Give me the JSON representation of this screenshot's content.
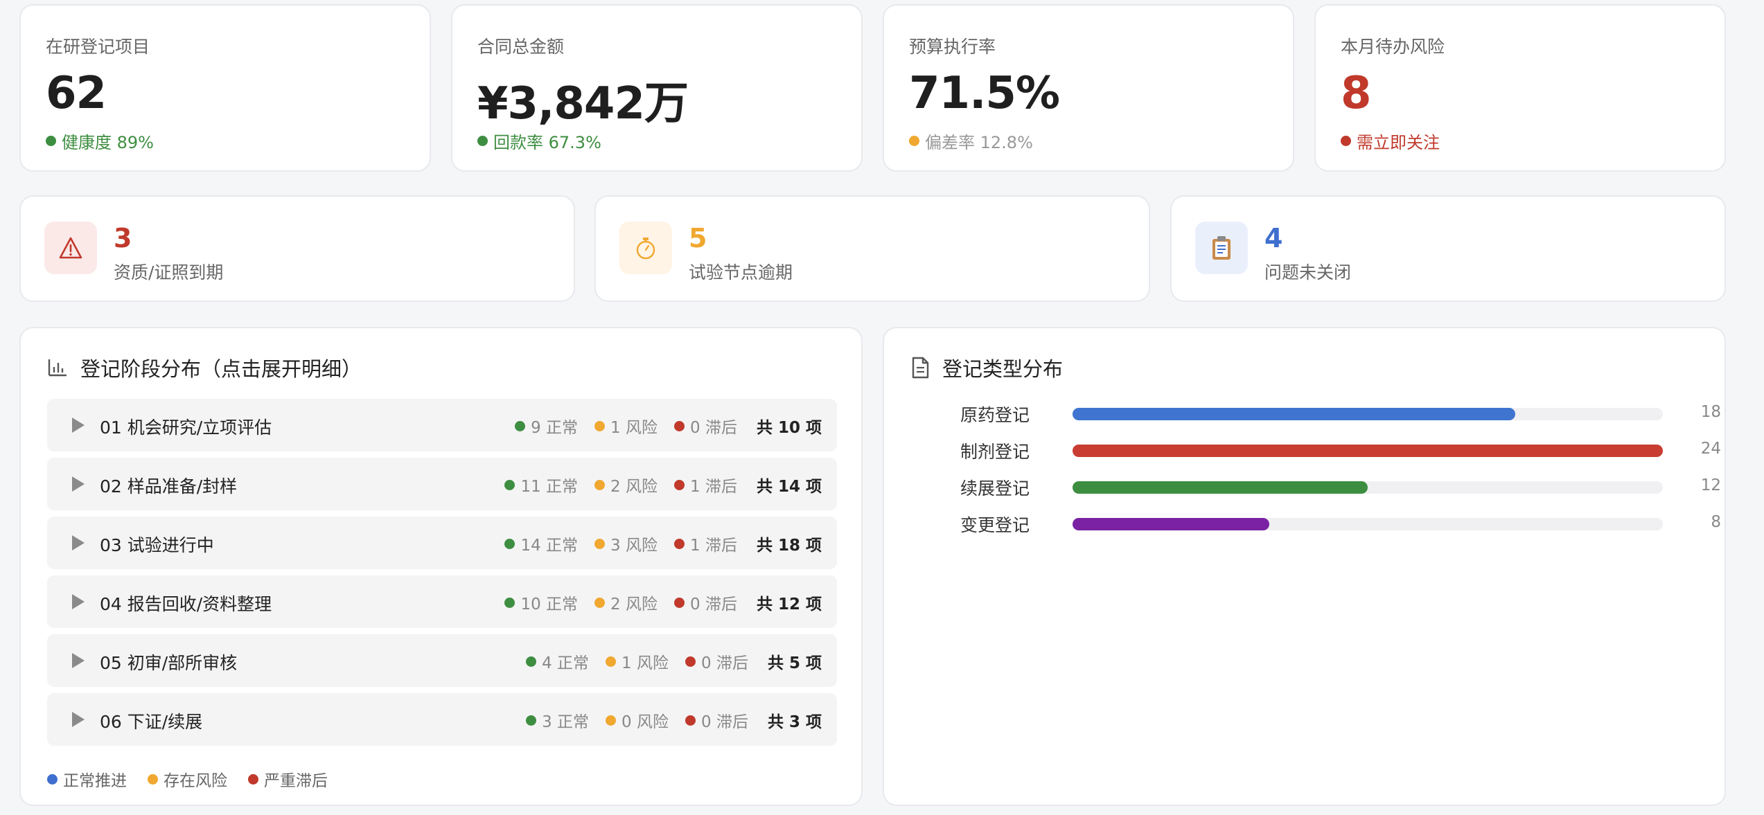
{
  "kpis": [
    {
      "label": "在研登记项目",
      "value": "62",
      "sub": "健康度 89%",
      "sub_color": "#3e8e41",
      "value_color": "#1f1f1f"
    },
    {
      "label": "合同总金额",
      "value": "¥3,842万",
      "sub": "回款率 67.3%",
      "sub_color": "#3e8e41",
      "value_color": "#1f1f1f"
    },
    {
      "label": "预算执行率",
      "value": "71.5%",
      "sub": "偏差率 12.8%",
      "sub_color": "#999999",
      "dot_color": "#f0a830",
      "value_color": "#1f1f1f"
    },
    {
      "label": "本月待办风险",
      "value": "8",
      "sub": "需立即关注",
      "sub_color": "#c0392b",
      "value_color": "#c0392b"
    }
  ],
  "alerts": [
    {
      "count": "3",
      "text": "资质/证照到期",
      "color": "#c0392b",
      "bg": "#fbe9e8",
      "icon": "warning-icon"
    },
    {
      "count": "5",
      "text": "试验节点逾期",
      "color": "#f0a830",
      "bg": "#fff4e5",
      "icon": "stopwatch-icon"
    },
    {
      "count": "4",
      "text": "问题未关闭",
      "color": "#3f6fcf",
      "bg": "#eaf0fb",
      "icon": "clipboard-icon"
    }
  ],
  "stages": {
    "title": "登记阶段分布（点击展开明细）",
    "rows": [
      {
        "name": "01 机会研究/立项评估",
        "normal": "9 正常",
        "risk": "1 风险",
        "late": "0 滞后",
        "total_prefix": "共",
        "total": "10",
        "total_suffix": "项"
      },
      {
        "name": "02 样品准备/封样",
        "normal": "11 正常",
        "risk": "2 风险",
        "late": "1 滞后",
        "total_prefix": "共",
        "total": "14",
        "total_suffix": "项"
      },
      {
        "name": "03 试验进行中",
        "normal": "14 正常",
        "risk": "3 风险",
        "late": "1 滞后",
        "total_prefix": "共",
        "total": "18",
        "total_suffix": "项"
      },
      {
        "name": "04 报告回收/资料整理",
        "normal": "10 正常",
        "risk": "2 风险",
        "late": "0 滞后",
        "total_prefix": "共",
        "total": "12",
        "total_suffix": "项"
      },
      {
        "name": "05 初审/部所审核",
        "normal": "4 正常",
        "risk": "1 风险",
        "late": "0 滞后",
        "total_prefix": "共",
        "total": "5",
        "total_suffix": "项"
      },
      {
        "name": "06 下证/续展",
        "normal": "3 正常",
        "risk": "0 风险",
        "late": "0 滞后",
        "total_prefix": "共",
        "total": "3",
        "total_suffix": "项"
      }
    ],
    "legend": [
      {
        "label": "正常推进",
        "color": "#3f6fcf"
      },
      {
        "label": "存在风险",
        "color": "#f0a830"
      },
      {
        "label": "严重滞后",
        "color": "#c0392b"
      }
    ],
    "colors": {
      "normal": "#3e8e41",
      "risk": "#f0a830",
      "late": "#c0392b"
    }
  },
  "types": {
    "title": "登记类型分布",
    "max": 24,
    "rows": [
      {
        "label": "原药登记",
        "value": 18,
        "display": "18",
        "color": "#3f74d0"
      },
      {
        "label": "制剂登记",
        "value": 24,
        "display": "24",
        "color": "#c83c32"
      },
      {
        "label": "续展登记",
        "value": 12,
        "display": "12",
        "color": "#3e8e41"
      },
      {
        "label": "变更登记",
        "value": 8,
        "display": "8",
        "color": "#7a22a3"
      }
    ]
  }
}
